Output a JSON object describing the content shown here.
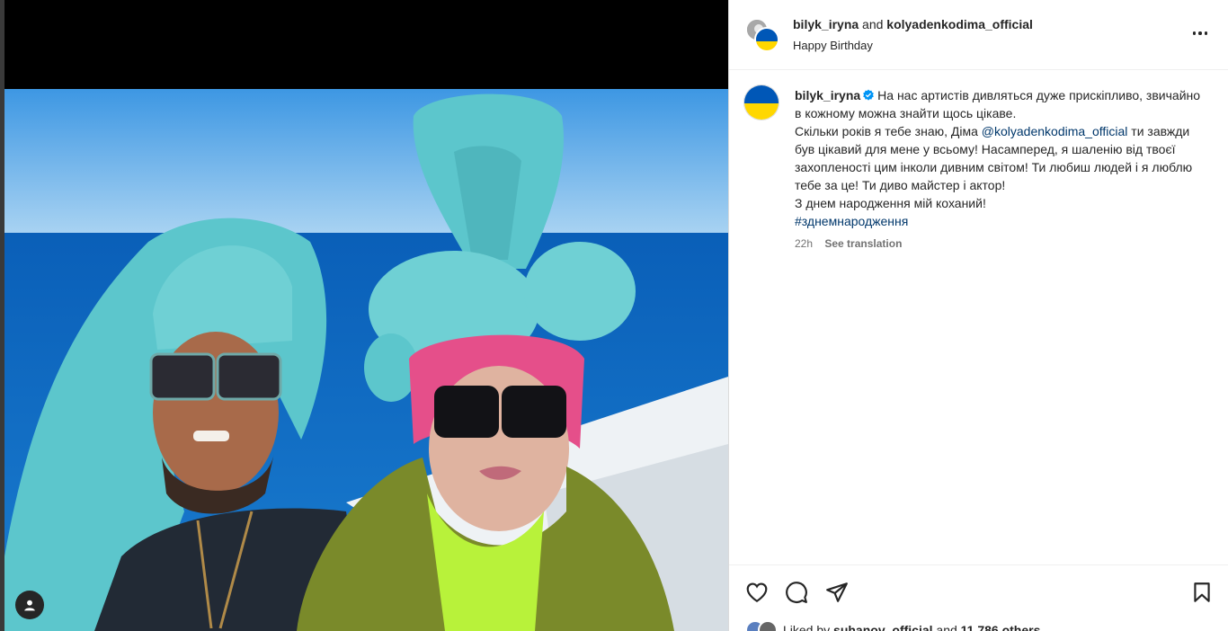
{
  "header": {
    "user1": "bilyk_iryna",
    "and_text": "and",
    "user2": "kolyadenkodima_official",
    "subtitle": "Happy Birthday",
    "more_icon": "more-horizontal-icon"
  },
  "caption": {
    "username": "bilyk_iryna",
    "verified_icon": "verified-badge-icon",
    "line1": "На нас артистів дивляться дуже прискіпливо, звичайно в кожному можна знайти щось цікаве.",
    "line2_before": "Скільки років я тебе знаю, Діма ",
    "mention": "@kolyadenkodima_official",
    "line2_after": " ти завжди був цікавий для мене у всьому! Насамперед, я шаленію від твоєї захопленості цим інколи дивним світом! Ти любиш людей і я люблю тебе за це! Ти диво майстер і актор!",
    "line3": "З днем народження мій коханий!",
    "hashtag": "#зднемнародження",
    "time": "22h",
    "see_translation": "See translation"
  },
  "actions": {
    "like_icon": "heart-icon",
    "comment_icon": "comment-icon",
    "share_icon": "send-icon",
    "save_icon": "bookmark-icon"
  },
  "likes": {
    "prefix": "Liked by",
    "user": "suhanov_official",
    "and_text": "and",
    "count": "11,786 others"
  },
  "media": {
    "tag_icon": "user-tag-icon"
  },
  "colors": {
    "link": "#00376b",
    "verified": "#0095f6",
    "flag_blue": "#0057b7",
    "flag_yellow": "#ffd700"
  }
}
